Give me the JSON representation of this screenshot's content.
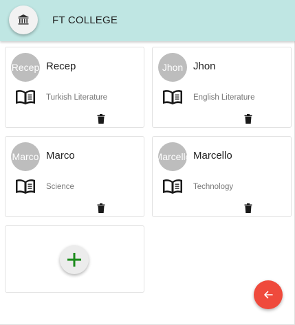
{
  "header": {
    "title": "FT COLLEGE",
    "logo_icon": "institution-icon",
    "background": "#bfe6e3"
  },
  "teachers": [
    {
      "avatar_text": "Recep",
      "name": "Recep",
      "subject": "Turkish Literature"
    },
    {
      "avatar_text": "Jhon",
      "name": "Jhon",
      "subject": "English Literature"
    },
    {
      "avatar_text": "Marco",
      "name": "Marco",
      "subject": "Science"
    },
    {
      "avatar_text": "Marcello",
      "name": "Marcello",
      "subject": "Technology"
    }
  ],
  "icons": {
    "subject": "book-open-icon",
    "delete": "trash-icon",
    "add": "plus-icon",
    "back": "arrow-left-icon"
  },
  "colors": {
    "add_plus": "#1a8a1a",
    "fab": "#ef4a3c",
    "avatar": "#bdbdbd"
  }
}
